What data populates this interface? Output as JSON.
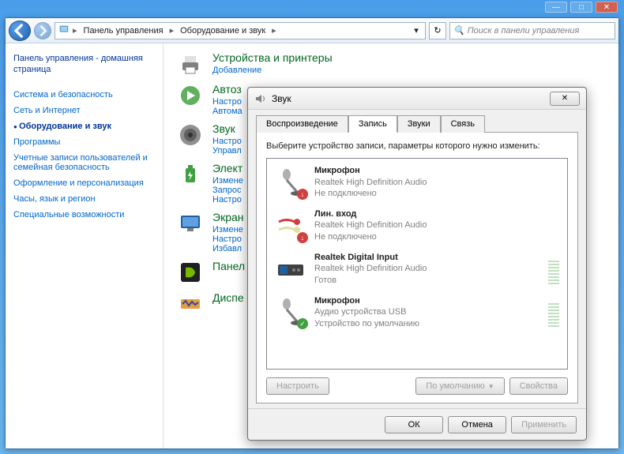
{
  "window": {
    "minimize": "—",
    "maximize": "□",
    "close": "✕"
  },
  "breadcrumb": {
    "seg1": "Панель управления",
    "seg2": "Оборудование и звук"
  },
  "search": {
    "placeholder": "Поиск в панели управления"
  },
  "sidebar": {
    "home": "Панель управления - домашняя страница",
    "items": [
      "Система и безопасность",
      "Сеть и Интернет",
      "Оборудование и звук",
      "Программы",
      "Учетные записи пользователей и семейная безопасность",
      "Оформление и персонализация",
      "Часы, язык и регион",
      "Специальные возможности"
    ],
    "active_index": 2
  },
  "categories": [
    {
      "title": "Устройства и принтеры",
      "sub": "Добавление"
    },
    {
      "title": "Автоз",
      "sub1": "Настро",
      "sub2": "Автома"
    },
    {
      "title": "Звук",
      "sub1": "Настро",
      "sub2": "Управл"
    },
    {
      "title": "Элект",
      "sub1": "Измене",
      "sub2": "Запрос",
      "sub3": "Настро"
    },
    {
      "title": "Экран",
      "sub1": "Измене",
      "sub2": "Настро",
      "sub3": "Избавл"
    },
    {
      "title": "Панел",
      "sub": ""
    },
    {
      "title": "Диспе",
      "sub": ""
    }
  ],
  "dialog": {
    "title": "Звук",
    "close": "✕",
    "tabs": [
      "Воспроизведение",
      "Запись",
      "Звуки",
      "Связь"
    ],
    "active_tab": 1,
    "instruction": "Выберите устройство записи, параметры которого нужно изменить:",
    "devices": [
      {
        "name": "Микрофон",
        "desc": "Realtek High Definition Audio",
        "status": "Не подключено",
        "badge": "red",
        "meter": false
      },
      {
        "name": "Лин. вход",
        "desc": "Realtek High Definition Audio",
        "status": "Не подключено",
        "badge": "red",
        "meter": false
      },
      {
        "name": "Realtek Digital Input",
        "desc": "Realtek High Definition Audio",
        "status": "Готов",
        "badge": "",
        "meter": true
      },
      {
        "name": "Микрофон",
        "desc": "Аудио устройства USB",
        "status": "Устройство по умолчанию",
        "badge": "green",
        "meter": true
      }
    ],
    "btn_configure": "Настроить",
    "btn_default": "По умолчанию",
    "btn_properties": "Свойства",
    "btn_ok": "ОК",
    "btn_cancel": "Отмена",
    "btn_apply": "Применить"
  }
}
